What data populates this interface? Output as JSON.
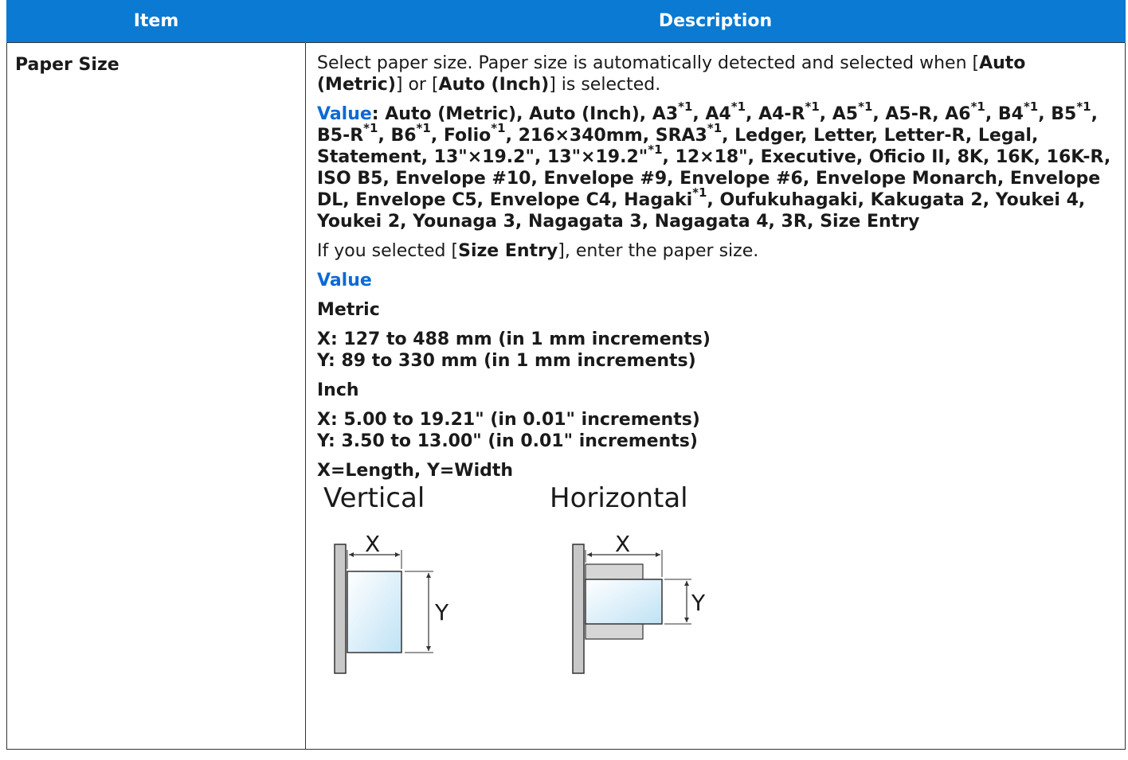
{
  "table": {
    "headers": {
      "item": "Item",
      "description": "Description"
    },
    "row": {
      "item": "Paper Size",
      "intro_1": "Select paper size. Paper size is automatically detected and selected when [",
      "auto_metric": "Auto (Metric)",
      "intro_2": "] or [",
      "auto_inch": "Auto (Inch)",
      "intro_3": "] is selected.",
      "value_label": "Value",
      "value_colon": ": ",
      "values_parts": [
        {
          "t": "Auto (Metric), Auto (Inch), A3"
        },
        {
          "s": "*1"
        },
        {
          "t": ", A4"
        },
        {
          "s": "*1"
        },
        {
          "t": ", A4-R"
        },
        {
          "s": "*1"
        },
        {
          "t": ", A5"
        },
        {
          "s": "*1"
        },
        {
          "t": ", A5-R, A6"
        },
        {
          "s": "*1"
        },
        {
          "t": ", B4"
        },
        {
          "s": "*1"
        },
        {
          "t": ", B5"
        },
        {
          "s": "*1"
        },
        {
          "t": ", B5-R"
        },
        {
          "s": "*1"
        },
        {
          "t": ", B6"
        },
        {
          "s": "*1"
        },
        {
          "t": ", Folio"
        },
        {
          "s": "*1"
        },
        {
          "t": ", 216×340mm, SRA3"
        },
        {
          "s": "*1"
        },
        {
          "t": ", Ledger, Letter, Letter-R, Legal, Statement, 13\"×19.2\", 13\"×19.2\""
        },
        {
          "s": "*1"
        },
        {
          "t": ", 12×18\", Executive, Oficio II, 8K, 16K, 16K-R, ISO B5, Envelope #10, Envelope #9, Envelope #6, Envelope Monarch, Envelope DL, Envelope C5, Envelope C4, Hagaki"
        },
        {
          "s": "*1"
        },
        {
          "t": ", Oufukuhagaki, Kakugata 2, Youkei 4, Youkei 2, Younaga 3, Nagagata 3, Nagagata 4, 3R, Size Entry"
        }
      ],
      "size_entry_1": "If you selected [",
      "size_entry_bold": "Size Entry",
      "size_entry_2": "], enter the paper size.",
      "value_heading": "Value",
      "metric_label": "Metric",
      "metric_x": "X: 127 to 488 mm (in 1 mm increments)",
      "metric_y": "Y: 89 to 330 mm (in 1 mm increments)",
      "inch_label": "Inch",
      "inch_x": "X: 5.00 to 19.21\" (in 0.01\" increments)",
      "inch_y": "Y: 3.50 to 13.00\" (in 0.01\" increments)",
      "xy_note": "X=Length, Y=Width",
      "figure": {
        "vertical_label": "Vertical",
        "horizontal_label": "Horizontal",
        "x_label": "X",
        "y_label": "Y"
      }
    }
  }
}
